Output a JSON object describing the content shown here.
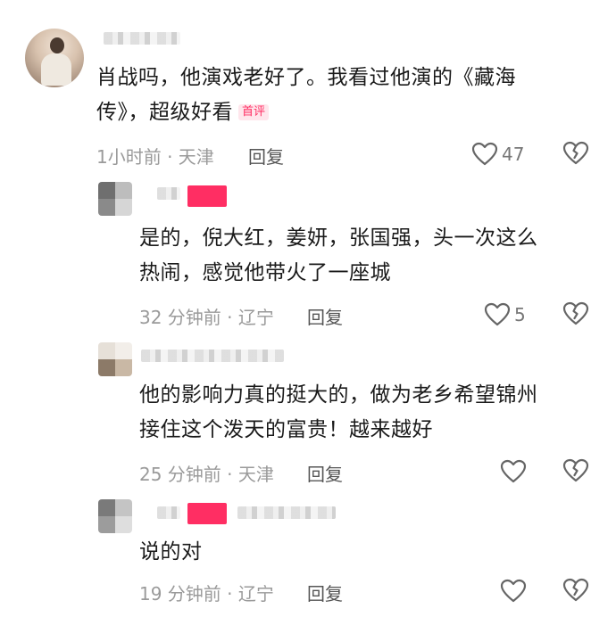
{
  "comments": [
    {
      "text_line1": "肖战吗，他演戏老好了。我看过他演的《藏海",
      "text_line2": "传》，超级好看",
      "badge": "首评",
      "time_location": "1小时前 · 天津",
      "reply_label": "回复",
      "like_count": "47",
      "like_icon": "heart-icon",
      "dislike_icon": "broken-heart-icon"
    },
    {
      "text_line1": "是的，倪大红，姜妍，张国强，头一次这么",
      "text_line2": "热闹，感觉他带火了一座城",
      "time_location": "32 分钟前 · 辽宁",
      "reply_label": "回复",
      "like_count": "5"
    },
    {
      "text_line1": "他的影响力真的挺大的，做为老乡希望锦州",
      "text_line2": "接住这个泼天的富贵！越来越好",
      "time_location": "25 分钟前 · 天津",
      "reply_label": "回复",
      "like_count": ""
    },
    {
      "text_line1": "说的对",
      "time_location": "19 分钟前 · 辽宁",
      "reply_label": "回复",
      "like_count": ""
    }
  ],
  "colors": {
    "accent_pink": "#ff2e63",
    "meta_gray": "#9a9a9a",
    "icon_gray": "#666666"
  }
}
